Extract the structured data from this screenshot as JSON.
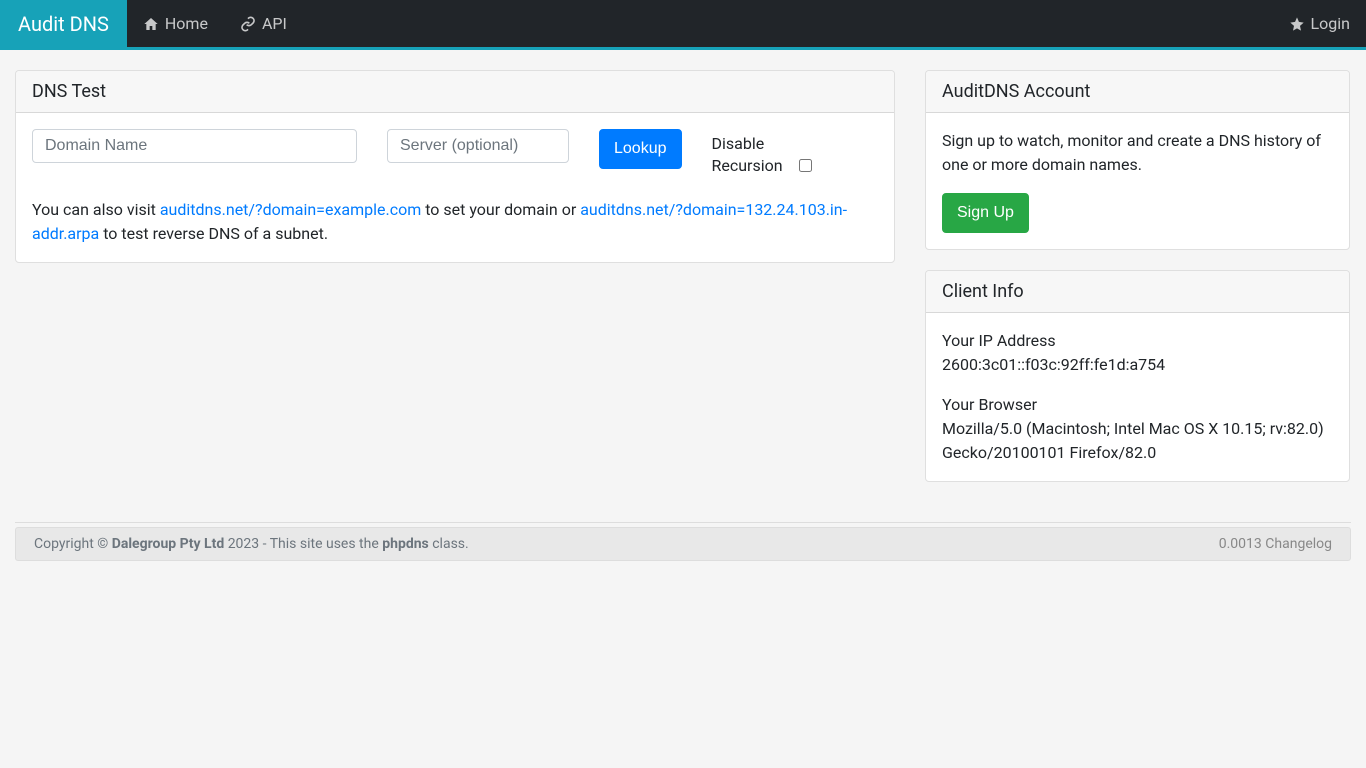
{
  "nav": {
    "brand": "Audit DNS",
    "home": "Home",
    "api": "API",
    "login": "Login"
  },
  "dnstest": {
    "title": "DNS Test",
    "domain_placeholder": "Domain Name",
    "server_placeholder": "Server (optional)",
    "lookup_label": "Lookup",
    "disable_recursion_label": "Disable Recursion",
    "help_prefix": "You can also visit ",
    "help_link1": "auditdns.net/?domain=example.com",
    "help_mid": " to set your domain or ",
    "help_link2": "auditdns.net/?domain=132.24.103.in-addr.arpa",
    "help_suffix": " to test reverse DNS of a subnet."
  },
  "account": {
    "title": "AuditDNS Account",
    "desc": "Sign up to watch, monitor and create a DNS history of one or more domain names.",
    "signup_label": "Sign Up"
  },
  "clientinfo": {
    "title": "Client Info",
    "ip_label": "Your IP Address",
    "ip_value": "2600:3c01::f03c:92ff:fe1d:a754",
    "browser_label": "Your Browser",
    "browser_value": "Mozilla/5.0 (Macintosh; Intel Mac OS X 10.15; rv:82.0) Gecko/20100101 Firefox/82.0"
  },
  "footer": {
    "copyright_prefix": "Copyright ",
    "company": "Dalegroup Pty Ltd",
    "year_text": " 2023 - This site uses the ",
    "phpdns": "phpdns",
    "class_suffix": " class.",
    "timing": "0.0013",
    "changelog": "Changelog"
  }
}
